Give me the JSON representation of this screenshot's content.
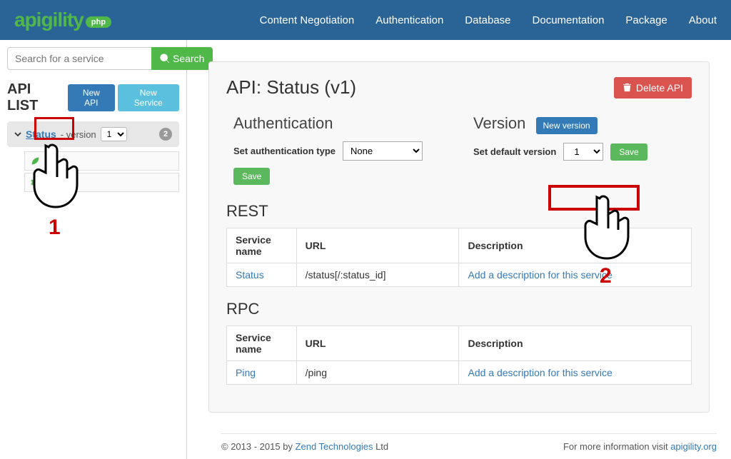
{
  "brand": {
    "name": "apigility",
    "tag": "php"
  },
  "nav": [
    {
      "label": "Content Negotiation"
    },
    {
      "label": "Authentication"
    },
    {
      "label": "Database"
    },
    {
      "label": "Documentation"
    },
    {
      "label": "Package"
    },
    {
      "label": "About"
    }
  ],
  "sidebar": {
    "search_placeholder": "Search for a service",
    "search_btn": "Search",
    "title": "API LIST",
    "new_api": "New API",
    "new_service": "New Service",
    "api": {
      "name": "Status",
      "version_label": "version",
      "version": "1",
      "count": "2"
    },
    "sub": [
      {
        "label": ""
      },
      {
        "label": ""
      }
    ]
  },
  "page": {
    "title": "API: Status (v1)",
    "delete": "Delete API",
    "auth": {
      "heading": "Authentication",
      "label": "Set authentication type",
      "value": "None",
      "save": "Save"
    },
    "ver": {
      "heading": "Version",
      "new": "New version",
      "label": "Set default version",
      "value": "1",
      "save": "Save"
    },
    "rest": {
      "heading": "REST",
      "cols": {
        "name": "Service name",
        "url": "URL",
        "desc": "Description"
      },
      "rows": [
        {
          "name": "Status",
          "url": "/status[/:status_id]",
          "desc": "Add a description for this service"
        }
      ]
    },
    "rpc": {
      "heading": "RPC",
      "cols": {
        "name": "Service name",
        "url": "URL",
        "desc": "Description"
      },
      "rows": [
        {
          "name": "Ping",
          "url": "/ping",
          "desc": "Add a description for this service"
        }
      ]
    }
  },
  "footer": {
    "left_pre": "© 2013 - 2015 by ",
    "left_link": "Zend Technologies",
    "left_post": " Ltd",
    "right_pre": "For more information visit ",
    "right_link": "apigility.org"
  },
  "annotations": {
    "step1": "1",
    "step2": "2"
  }
}
